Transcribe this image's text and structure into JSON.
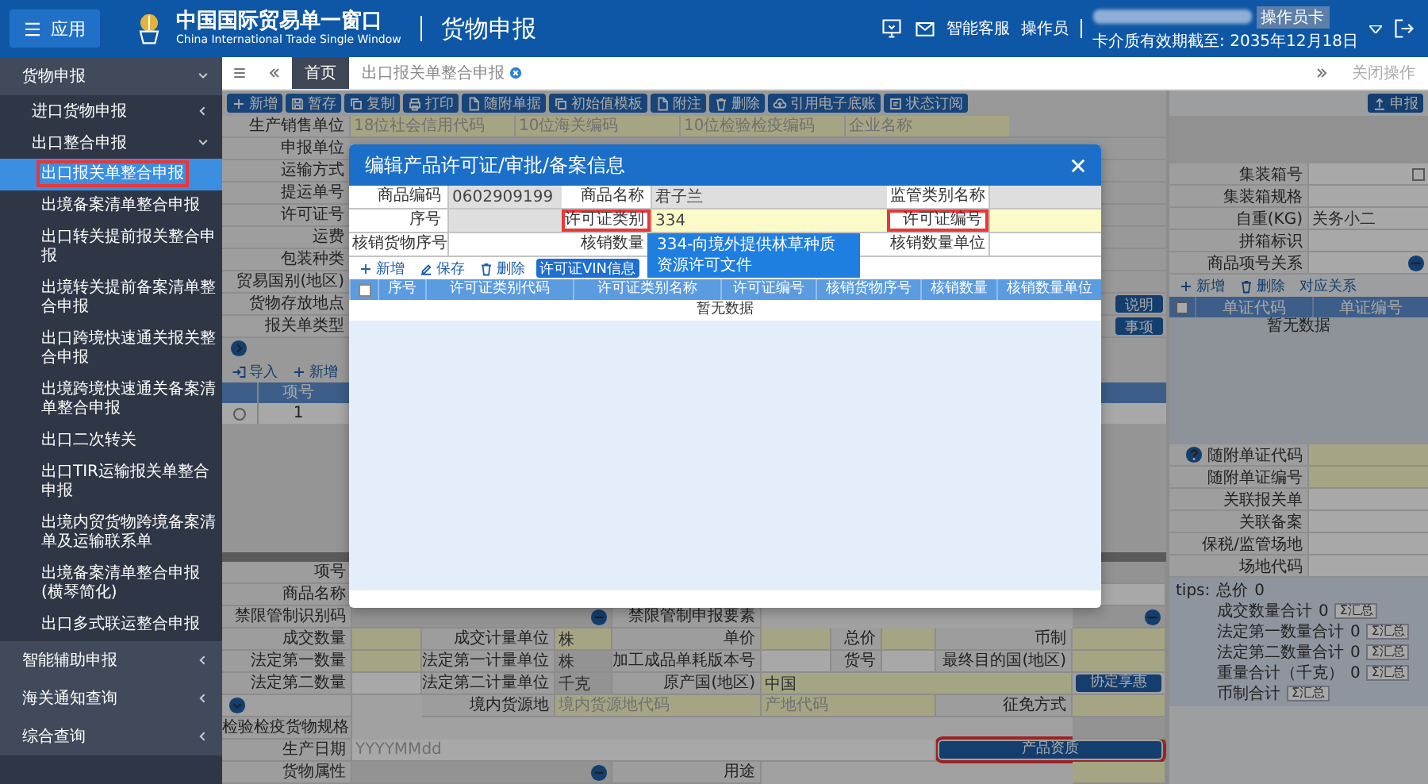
{
  "header": {
    "menu_button": "应用",
    "title": "中国国际贸易单一窗口",
    "subtitle": "China International Trade Single Window",
    "module": "货物申报",
    "service": "智能客服",
    "operator": "操作员",
    "card_badge": "操作员卡",
    "expiry": "卡介质有效期截至: 2035年12月18日"
  },
  "sidebar": {
    "modules": [
      {
        "label": "货物申报",
        "expanded": true,
        "children": [
          {
            "label": "进口货物申报",
            "expanded": false
          },
          {
            "label": "出口整合申报",
            "expanded": true,
            "children": [
              {
                "label": "出口报关单整合申报",
                "selected": true,
                "highlighted": true
              },
              {
                "label": "出境备案清单整合申报",
                "selected": false,
                "highlighted": false
              },
              {
                "label": "出口转关提前报关整合申报",
                "selected": false,
                "highlighted": false
              },
              {
                "label": "出境转关提前备案清单整合申报",
                "selected": false,
                "highlighted": false
              },
              {
                "label": "出口跨境快速通关报关整合申报",
                "selected": false,
                "highlighted": false
              },
              {
                "label": "出境跨境快速通关备案清单整合申报",
                "selected": false,
                "highlighted": false
              },
              {
                "label": "出口二次转关",
                "selected": false,
                "highlighted": false
              },
              {
                "label": "出口TIR运输报关单整合申报",
                "selected": false,
                "highlighted": false
              },
              {
                "label": "出境内贸货物跨境备案清单及运输联系单",
                "selected": false,
                "highlighted": false
              },
              {
                "label": "出境备案清单整合申报(横琴简化)",
                "selected": false,
                "highlighted": false
              },
              {
                "label": "出口多式联运整合申报",
                "selected": false,
                "highlighted": false
              }
            ]
          }
        ]
      },
      {
        "label": "智能辅助申报",
        "expanded": false
      },
      {
        "label": "海关通知查询",
        "expanded": false
      },
      {
        "label": "综合查询",
        "expanded": false
      }
    ]
  },
  "tabs": [
    {
      "label": "首页",
      "selected": false,
      "closable": false
    },
    {
      "label": "出口报关单整合申报",
      "selected": true,
      "closable": true
    }
  ],
  "close_all": "关闭操作",
  "toolbar": [
    {
      "label": "新增",
      "kind": "add"
    },
    {
      "label": "暂存",
      "kind": "save"
    },
    {
      "label": "复制",
      "kind": "copy"
    },
    {
      "label": "打印",
      "kind": "print"
    },
    {
      "label": "随附单据",
      "kind": "doc"
    },
    {
      "label": "初始值模板",
      "kind": "copy"
    },
    {
      "label": "附注",
      "kind": "doc"
    },
    {
      "label": "删除",
      "kind": "delete"
    },
    {
      "label": "引用电子底账",
      "kind": "cloud"
    },
    {
      "label": "状态订阅",
      "kind": "list"
    }
  ],
  "top_form": {
    "rows": [
      {
        "label": "生产销售单位",
        "inputs": [
          {
            "placeholder": "18位社会信用代码",
            "required": true,
            "readonly": false
          },
          {
            "placeholder": "10位海关编码",
            "required": true,
            "readonly": false
          },
          {
            "placeholder": "10位检验检疫编码",
            "required": true,
            "readonly": false
          },
          {
            "placeholder": "企业名称",
            "required": true,
            "readonly": false
          }
        ]
      },
      {
        "label": "申报单位"
      },
      {
        "label": "运输方式"
      },
      {
        "label": "提运单号"
      },
      {
        "label": "许可证号"
      },
      {
        "label": "运费"
      },
      {
        "label": "包装种类"
      },
      {
        "label": "贸易国别(地区)"
      },
      {
        "label": "货物存放地点",
        "button": "说明"
      },
      {
        "label": "报关单类型",
        "button": "事项"
      }
    ]
  },
  "goods": {
    "toolbar": [
      {
        "label": "导入",
        "kind": "import"
      },
      {
        "label": "新增",
        "kind": "add"
      }
    ],
    "columns": [
      "项号"
    ],
    "rows": [
      {
        "cells": [
          "1"
        ],
        "selected": false
      }
    ]
  },
  "lower_form": [
    [
      {
        "kind": "label",
        "text": "项号"
      },
      {
        "kind": "input-rest",
        "required": false,
        "readonly": true
      }
    ],
    [
      {
        "kind": "label",
        "text": "商品名称"
      },
      {
        "kind": "input-rest",
        "required": false,
        "readonly": false
      }
    ],
    [
      {
        "kind": "label",
        "text": "禁限管制识别码"
      },
      {
        "kind": "lookup-3",
        "required": false,
        "readonly": true
      },
      {
        "kind": "label",
        "text": "禁限管制申报要素"
      },
      {
        "kind": "lookup-rest",
        "required": false,
        "readonly": true
      }
    ],
    [
      {
        "kind": "label",
        "text": "成交数量"
      },
      {
        "kind": "input",
        "required": true,
        "readonly": false
      },
      {
        "kind": "label",
        "text": "成交计量单位"
      },
      {
        "kind": "input",
        "required": true,
        "readonly": false,
        "value": "株"
      },
      {
        "kind": "label",
        "text": "单价"
      },
      {
        "kind": "input",
        "required": true,
        "readonly": false
      },
      {
        "kind": "label",
        "text": "总价"
      },
      {
        "kind": "input",
        "required": true,
        "readonly": false
      },
      {
        "kind": "label",
        "text": "币制"
      },
      {
        "kind": "input",
        "required": true,
        "readonly": false
      }
    ],
    [
      {
        "kind": "label",
        "text": "法定第一数量"
      },
      {
        "kind": "input",
        "required": true,
        "readonly": false
      },
      {
        "kind": "label",
        "text": "法定第一计量单位"
      },
      {
        "kind": "input",
        "required": false,
        "readonly": true,
        "value": "株"
      },
      {
        "kind": "label",
        "text": "加工成品单耗版本号"
      },
      {
        "kind": "input",
        "required": false,
        "readonly": false
      },
      {
        "kind": "label",
        "text": "货号"
      },
      {
        "kind": "input",
        "required": false,
        "readonly": false
      },
      {
        "kind": "label",
        "text": "最终目的国(地区)"
      },
      {
        "kind": "input",
        "required": true,
        "readonly": false
      }
    ],
    [
      {
        "kind": "label",
        "text": "法定第二数量"
      },
      {
        "kind": "input",
        "required": false,
        "readonly": false
      },
      {
        "kind": "label",
        "text": "法定第二计量单位"
      },
      {
        "kind": "input",
        "required": false,
        "readonly": true,
        "value": "千克"
      },
      {
        "kind": "label",
        "text": "原产国(地区)"
      },
      {
        "kind": "input-4",
        "required": true,
        "readonly": false,
        "value": "中国"
      },
      {
        "kind": "button",
        "text": "协定享惠",
        "highlighted": false
      }
    ],
    [
      {
        "kind": "expander"
      },
      {
        "kind": "spacer"
      },
      {
        "kind": "label",
        "text": "境内货源地"
      },
      {
        "kind": "input-2",
        "required": true,
        "readonly": false,
        "placeholder": "境内货源地代码"
      },
      {
        "kind": "input-3",
        "required": true,
        "readonly": false,
        "placeholder": "产地代码"
      },
      {
        "kind": "label",
        "text": "征免方式"
      },
      {
        "kind": "input",
        "required": true,
        "readonly": false
      }
    ],
    [
      {
        "kind": "label",
        "text": "检验检疫货物规格"
      },
      {
        "kind": "input-rest",
        "required": false,
        "readonly": true
      }
    ],
    [
      {
        "kind": "label",
        "text": "生产日期"
      },
      {
        "kind": "input-7",
        "required": false,
        "readonly": false,
        "placeholder": "YYYYMMdd"
      },
      {
        "kind": "button-2",
        "text": "产品资质",
        "highlighted": true
      }
    ],
    [
      {
        "kind": "label",
        "text": "货物属性"
      },
      {
        "kind": "lookup-3",
        "required": false,
        "readonly": true
      },
      {
        "kind": "label",
        "text": "用途"
      },
      {
        "kind": "input-rest",
        "required": true,
        "readonly": false
      }
    ]
  ],
  "right_panel": {
    "submit": "申报",
    "fields": [
      {
        "label": "集装箱号",
        "kind": "check",
        "checked": false
      },
      {
        "label": "集装箱规格",
        "kind": "plain"
      },
      {
        "label": "自重(KG)",
        "kind": "plain",
        "value": "关务小二"
      },
      {
        "label": "拼箱标识",
        "kind": "plain"
      },
      {
        "label": "商品项号关系",
        "kind": "lookup"
      }
    ],
    "toolbar": [
      {
        "label": "新增",
        "kind": "add"
      },
      {
        "label": "删除",
        "kind": "delete"
      },
      {
        "label": "对应关系",
        "kind": "text"
      }
    ],
    "all_checked": false,
    "columns": [
      "单证代码",
      "单证编号"
    ],
    "empty_text": "暂无数据",
    "fields2": [
      {
        "label": "随附单证代码",
        "kind": "help",
        "required": true,
        "readonly": false
      },
      {
        "label": "随附单证编号",
        "kind": "plain",
        "required": true,
        "readonly": false
      },
      {
        "label": "关联报关单",
        "kind": "plain",
        "required": false,
        "readonly": false
      },
      {
        "label": "关联备案",
        "kind": "plain",
        "required": false,
        "readonly": false
      },
      {
        "label": "保税/监管场地",
        "kind": "plain",
        "required": false,
        "readonly": false
      },
      {
        "label": "场地代码",
        "kind": "plain",
        "required": false,
        "readonly": false
      }
    ],
    "tips": {
      "title": "tips:",
      "total_label": "总价",
      "total_value": "0",
      "sums": [
        {
          "label": "成交数量合计",
          "value": "0",
          "button": "Σ汇总"
        },
        {
          "label": "法定第一数量合计",
          "value": "0",
          "button": "Σ汇总"
        },
        {
          "label": "法定第二数量合计",
          "value": "0",
          "button": "Σ汇总"
        },
        {
          "label": "重量合计（千克）",
          "value": "0",
          "button": "Σ汇总"
        },
        {
          "label": "币制合计",
          "button": "Σ汇总"
        }
      ]
    }
  },
  "dialog": {
    "title": "编辑产品许可证/审批/备案信息",
    "fields": [
      {
        "label": "商品编码",
        "value": "0602909199",
        "required": false,
        "readonly": true,
        "highlighted": false
      },
      {
        "label": "商品名称",
        "value": "君子兰",
        "required": false,
        "readonly": true,
        "highlighted": false
      },
      {
        "label": "监管类别名称",
        "required": false,
        "readonly": true,
        "highlighted": false
      },
      {
        "label": "序号",
        "required": false,
        "readonly": true,
        "highlighted": false
      },
      {
        "label": "许可证类别",
        "value": "334",
        "required": true,
        "readonly": false,
        "highlighted": true
      },
      {
        "label": "许可证编号",
        "required": true,
        "readonly": false,
        "highlighted": true
      },
      {
        "label": "核销货物序号",
        "required": false,
        "readonly": false,
        "highlighted": false
      },
      {
        "label": "核销数量",
        "required": false,
        "readonly": false,
        "highlighted": false
      },
      {
        "label": "核销数量单位",
        "required": false,
        "readonly": false,
        "highlighted": false
      }
    ],
    "suggestion": "334-向境外提供林草种质资源许可文件",
    "toolbar": [
      {
        "label": "新增",
        "kind": "add"
      },
      {
        "label": "保存",
        "kind": "edit"
      },
      {
        "label": "删除",
        "kind": "delete"
      },
      {
        "label": "许可证VIN信息",
        "kind": "primary"
      }
    ],
    "all_checked": false,
    "columns": [
      "序号",
      "许可证类别代码",
      "许可证类别名称",
      "许可证编号",
      "核销货物序号",
      "核销数量",
      "核销数量单位"
    ],
    "empty_text": "暂无数据"
  }
}
